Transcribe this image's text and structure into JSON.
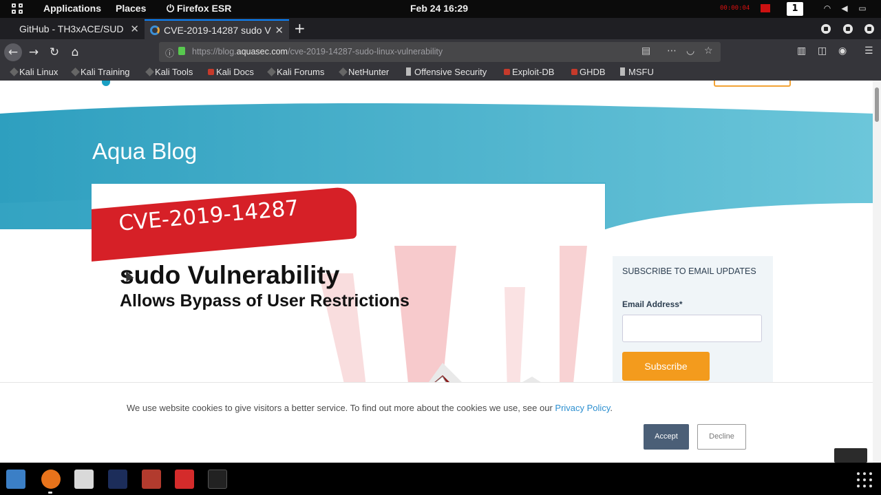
{
  "panel": {
    "applications": "Applications",
    "places": "Places",
    "active_app": "Firefox ESR",
    "clock": "Feb 24  16:29",
    "recording": "00:00:04",
    "workspace": "1"
  },
  "tabs": [
    {
      "label": "GitHub - TH3xACE/SUD",
      "close": "✕"
    },
    {
      "label": "CVE-2019-14287 sudo V",
      "close": "✕"
    }
  ],
  "new_tab": "+",
  "url": {
    "prefix": "https://blog.",
    "domain": "aquasec.com",
    "path": "/cve-2019-14287-sudo-linux-vulnerability"
  },
  "bookmarks": [
    "Kali Linux",
    "Kali Training",
    "Kali Tools",
    "Kali Docs",
    "Kali Forums",
    "NetHunter",
    "Offensive Security",
    "Exploit-DB",
    "GHDB",
    "MSFU"
  ],
  "page": {
    "blog_title": "Aqua Blog",
    "cve_tag": "CVE-2019-14287",
    "headline": "sudo Vulnerability",
    "subheadline": "Allows Bypass of User Restrictions",
    "subscribe": {
      "heading": "SUBSCRIBE TO EMAIL UPDATES",
      "email_label": "Email Address*",
      "email_value": "",
      "button": "Subscribe"
    },
    "cookie": {
      "message": "We use website cookies to give visitors a better service. To find out more about the cookies we use, see our ",
      "link": "Privacy Policy",
      "period": ".",
      "accept": "Accept",
      "decline": "Decline"
    }
  },
  "colors": {
    "hero_teal": "#3fb0cc",
    "cve_red": "#d62027",
    "subscribe_orange": "#f39b1d",
    "accept_blue": "#4b5f77",
    "tab_accent": "#0a84ff"
  }
}
